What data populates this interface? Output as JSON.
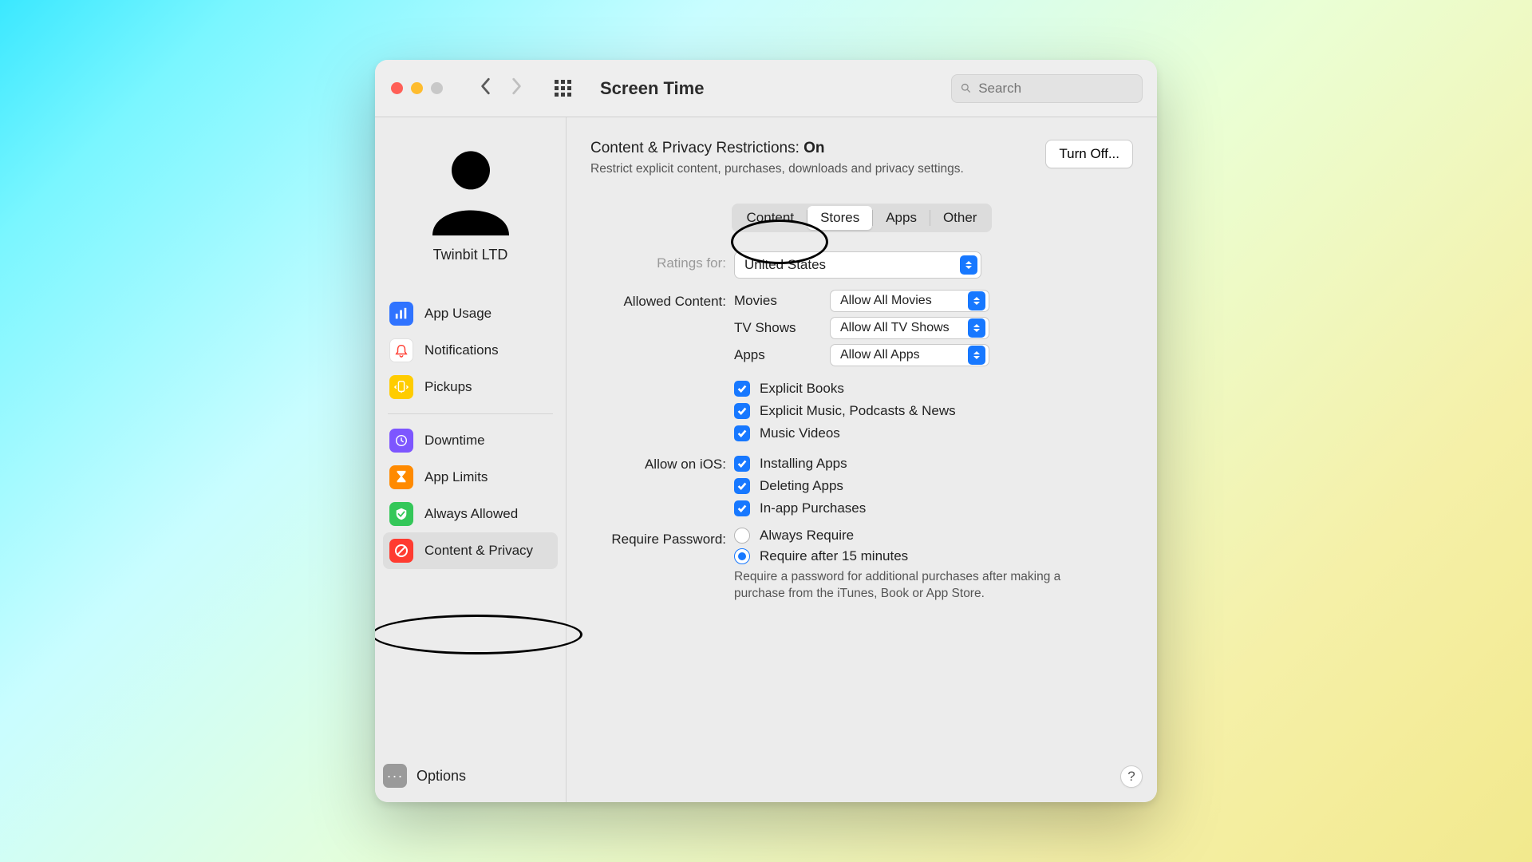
{
  "toolbar": {
    "title": "Screen Time",
    "search_placeholder": "Search"
  },
  "sidebar": {
    "account_name": "Twinbit LTD",
    "items": [
      {
        "label": "App Usage"
      },
      {
        "label": "Notifications"
      },
      {
        "label": "Pickups"
      },
      {
        "label": "Downtime"
      },
      {
        "label": "App Limits"
      },
      {
        "label": "Always Allowed"
      },
      {
        "label": "Content & Privacy"
      }
    ],
    "options_label": "Options"
  },
  "header": {
    "title_prefix": "Content & Privacy Restrictions: ",
    "status": "On",
    "turnoff_label": "Turn Off...",
    "subtitle": "Restrict explicit content, purchases, downloads and privacy settings."
  },
  "tabs": [
    "Content",
    "Stores",
    "Apps",
    "Other"
  ],
  "active_tab": "Stores",
  "ratings": {
    "label": "Ratings for:",
    "value": "United States"
  },
  "allowed_content": {
    "label": "Allowed Content:",
    "rows": [
      {
        "name": "Movies",
        "value": "Allow All Movies"
      },
      {
        "name": "TV Shows",
        "value": "Allow All TV Shows"
      },
      {
        "name": "Apps",
        "value": "Allow All Apps"
      }
    ],
    "checks": [
      "Explicit Books",
      "Explicit Music, Podcasts & News",
      "Music Videos"
    ]
  },
  "allow_ios": {
    "label": "Allow on iOS:",
    "checks": [
      "Installing Apps",
      "Deleting Apps",
      "In-app Purchases"
    ]
  },
  "require_password": {
    "label": "Require Password:",
    "options": [
      "Always Require",
      "Require after 15 minutes"
    ],
    "selected_index": 1,
    "hint": "Require a password for additional purchases after making a purchase from the iTunes, Book or App Store."
  }
}
